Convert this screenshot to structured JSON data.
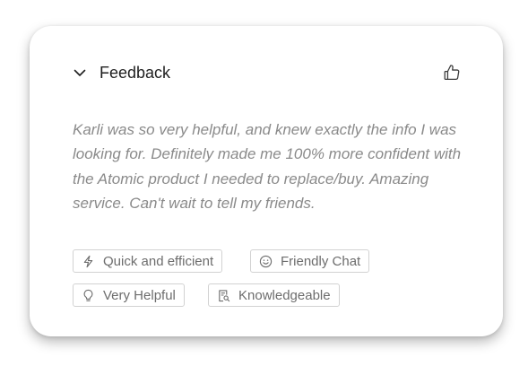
{
  "feedback": {
    "title": "Feedback",
    "collapse_icon": "chevron-down-icon",
    "rating_icon": "thumbs-up-icon",
    "comment": "Karli was so very helpful, and knew exactly the info I was looking for. Definitely made me 100% more confident with the Atomic product I needed to replace/buy. Amazing service. Can't wait to tell my friends.",
    "tags": [
      {
        "label": "Quick and efficient",
        "icon": "lightning-icon"
      },
      {
        "label": "Friendly Chat",
        "icon": "smiley-icon"
      },
      {
        "label": "Very Helpful",
        "icon": "lightbulb-icon"
      },
      {
        "label": "Knowledgeable",
        "icon": "document-search-icon"
      }
    ]
  },
  "colors": {
    "title_text": "#1f1f1f",
    "comment_text": "#8a8a8a",
    "tag_text": "#6d6d6d",
    "tag_border": "#d2d2d2"
  }
}
